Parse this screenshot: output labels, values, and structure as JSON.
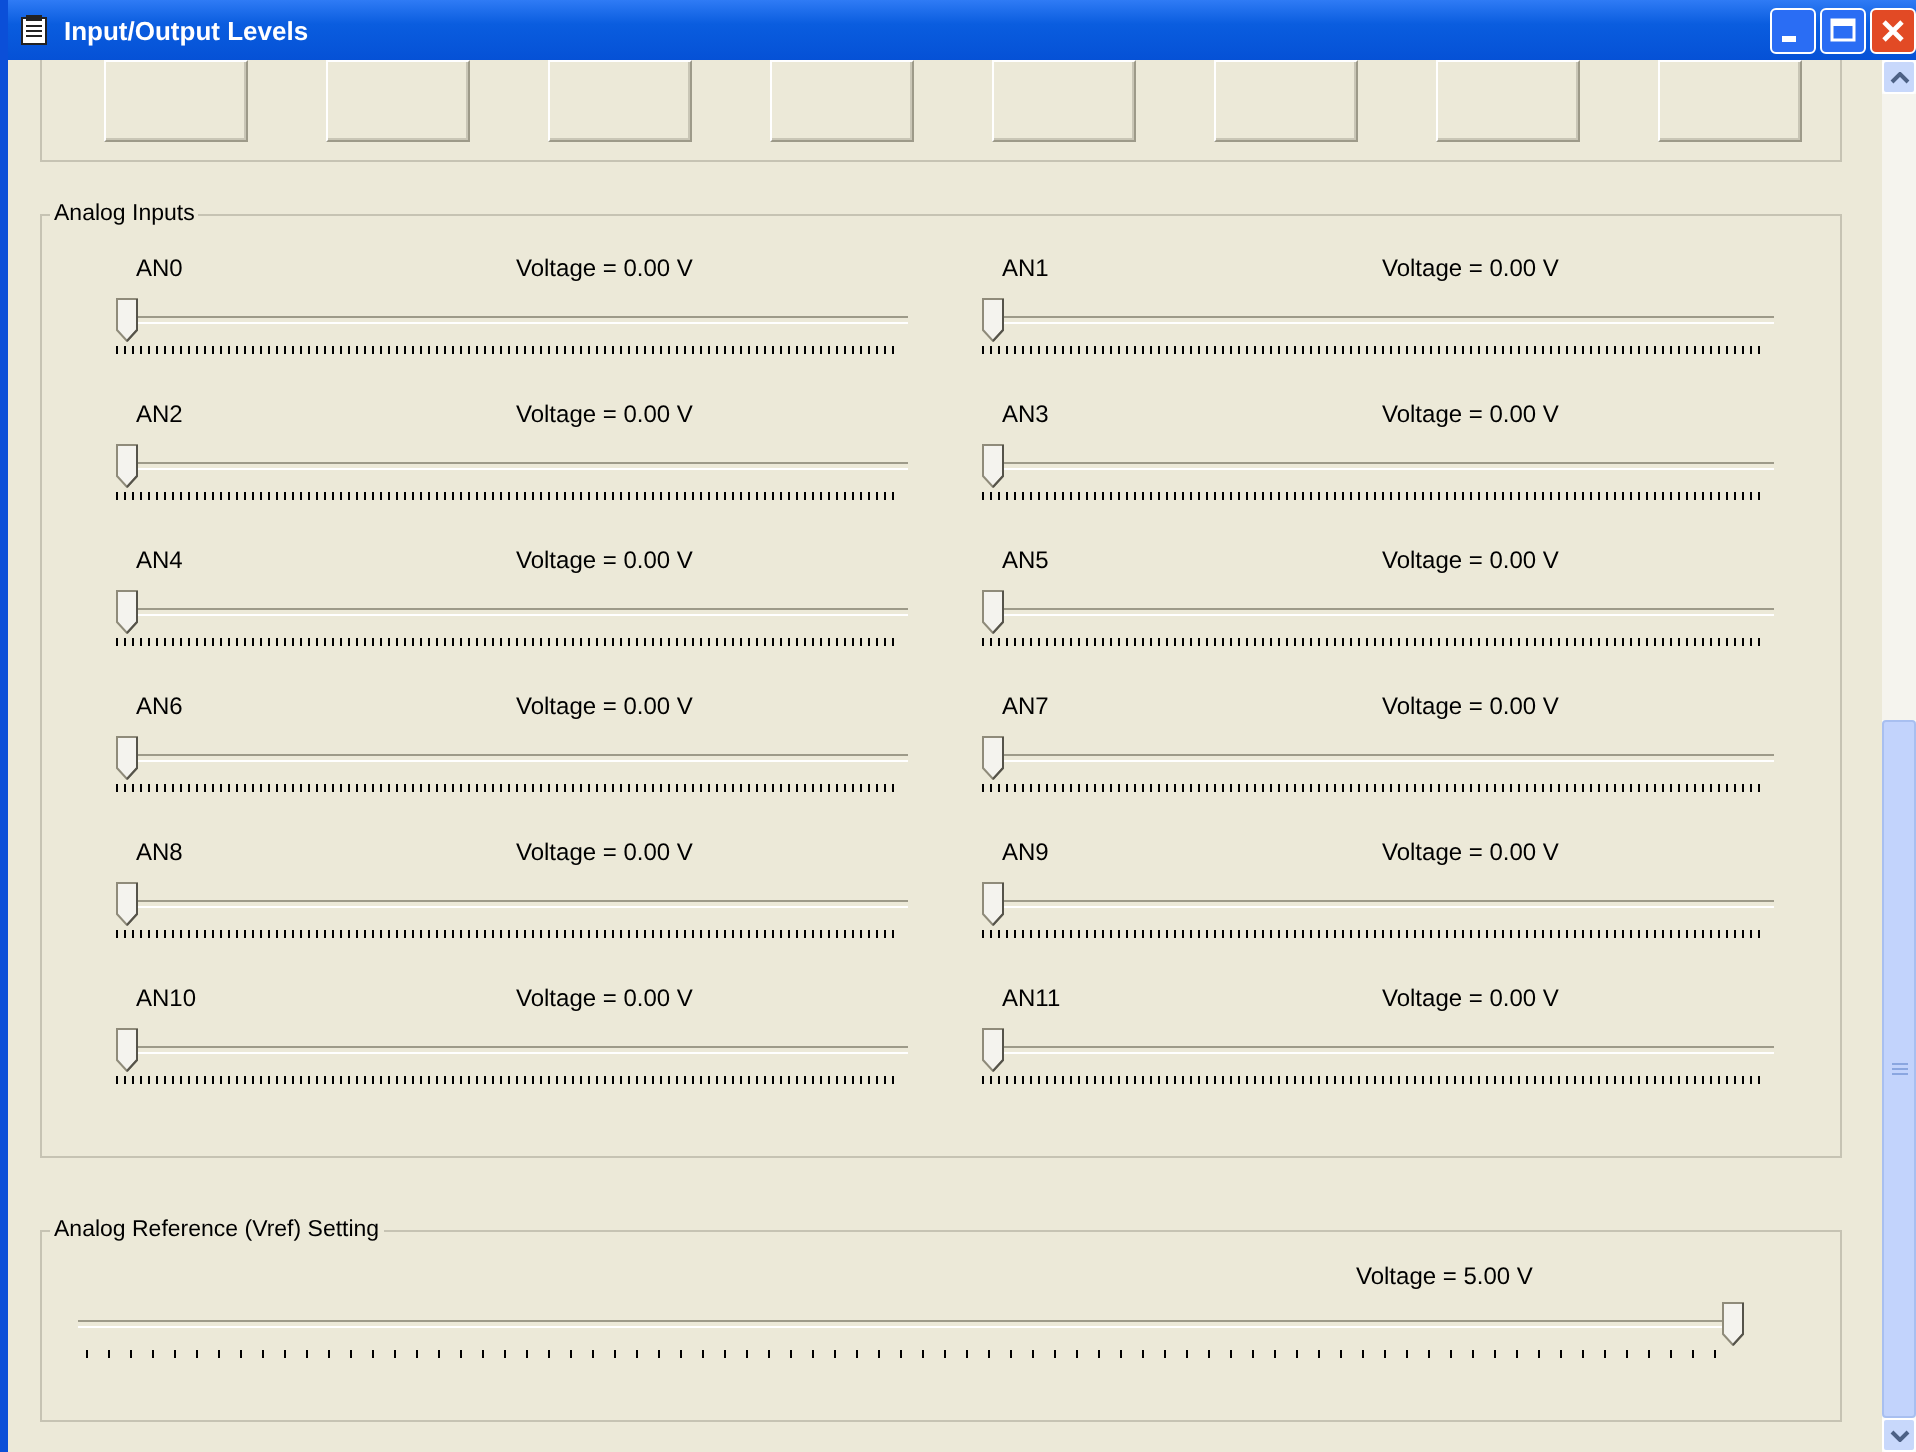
{
  "window": {
    "title": "Input/Output Levels"
  },
  "top_buttons": [
    {
      "disabled": true
    },
    {
      "disabled": true
    },
    {
      "disabled": true
    },
    {
      "disabled": true
    },
    {
      "disabled": true
    },
    {
      "disabled": true
    },
    {
      "disabled": true
    },
    {
      "disabled": true
    }
  ],
  "analog_inputs": {
    "title": "Analog Inputs",
    "channels": [
      {
        "name": "AN0",
        "reading": "Voltage = 0.00 V",
        "level": 0
      },
      {
        "name": "AN1",
        "reading": "Voltage = 0.00 V",
        "level": 0
      },
      {
        "name": "AN2",
        "reading": "Voltage = 0.00 V",
        "level": 0
      },
      {
        "name": "AN3",
        "reading": "Voltage = 0.00 V",
        "level": 0
      },
      {
        "name": "AN4",
        "reading": "Voltage = 0.00 V",
        "level": 0
      },
      {
        "name": "AN5",
        "reading": "Voltage = 0.00 V",
        "level": 0
      },
      {
        "name": "AN6",
        "reading": "Voltage = 0.00 V",
        "level": 0
      },
      {
        "name": "AN7",
        "reading": "Voltage = 0.00 V",
        "level": 0
      },
      {
        "name": "AN8",
        "reading": "Voltage = 0.00 V",
        "level": 0
      },
      {
        "name": "AN9",
        "reading": "Voltage = 0.00 V",
        "level": 0
      },
      {
        "name": "AN10",
        "reading": "Voltage = 0.00 V",
        "level": 0
      },
      {
        "name": "AN11",
        "reading": "Voltage = 0.00 V",
        "level": 0
      }
    ]
  },
  "vref": {
    "title": "Analog Reference (Vref) Setting",
    "reading": "Voltage = 5.00 V",
    "level": 1
  }
}
